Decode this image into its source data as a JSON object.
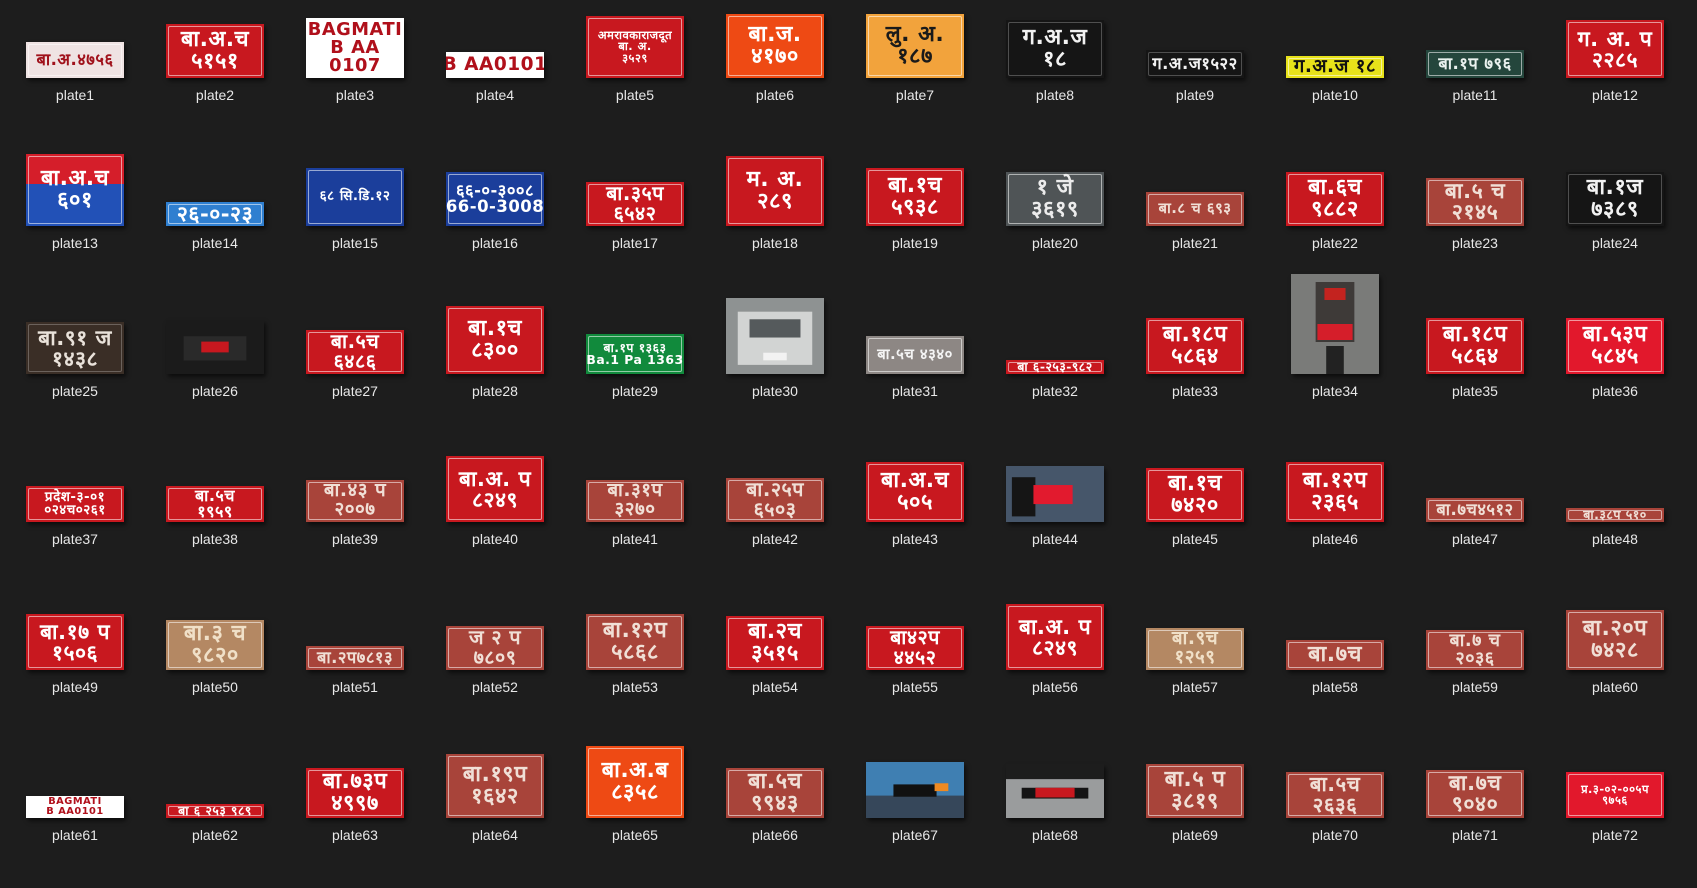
{
  "window": {
    "background": "#1d1d1d"
  },
  "items": [
    {
      "label": "plate1",
      "style": "light",
      "text": "बा.अ.४७५६",
      "photo": false
    },
    {
      "label": "plate2",
      "style": "red",
      "text": "बा.अ.च\n५१५१",
      "photo": false
    },
    {
      "label": "plate3",
      "style": "white",
      "text": "BAGMATI\nB AA\n0107",
      "photo": false
    },
    {
      "label": "plate4",
      "style": "white",
      "text": "B AA0101",
      "photo": false
    },
    {
      "label": "plate5",
      "style": "red",
      "text": "अमरावकाराजदूत\nबा. अ.\n३५२९",
      "photo": false
    },
    {
      "label": "plate6",
      "style": "orange",
      "text": "बा.ज.\n४१७०",
      "photo": false
    },
    {
      "label": "plate7",
      "style": "yellow",
      "text": "लु. अ.\n१८७",
      "photo": false
    },
    {
      "label": "plate8",
      "style": "black",
      "text": "ग.अ.ज\n१८",
      "photo": false
    },
    {
      "label": "plate9",
      "style": "black",
      "text": "ग.अ.ज१५२२",
      "photo": false
    },
    {
      "label": "plate10",
      "style": "yellowbright",
      "text": "ग.अ.ज १८",
      "photo": false
    },
    {
      "label": "plate11",
      "style": "darkgreen",
      "text": "बा.१प ७९६",
      "photo": false
    },
    {
      "label": "plate12",
      "style": "red",
      "text": "ग. अ. प\n२२८५",
      "photo": false
    },
    {
      "label": "plate13",
      "style": "split",
      "text": "बा.अ.च\n६०१",
      "photo": false
    },
    {
      "label": "plate14",
      "style": "blue",
      "text": "२६-०-२३",
      "photo": false
    },
    {
      "label": "plate15",
      "style": "navy",
      "text": "६८ सि.डि.१२",
      "photo": false
    },
    {
      "label": "plate16",
      "style": "navy",
      "text": "६६-०-३००८\n66-0-3008",
      "photo": false
    },
    {
      "label": "plate17",
      "style": "red",
      "text": "बा.३५प\n६५४२",
      "photo": false
    },
    {
      "label": "plate18",
      "style": "red",
      "text": "म. अ.\n२८९",
      "photo": false
    },
    {
      "label": "plate19",
      "style": "red",
      "text": "बा.१च\n५९३८",
      "photo": false
    },
    {
      "label": "plate20",
      "style": "grey",
      "text": "१ जे\n३६१९",
      "photo": false
    },
    {
      "label": "plate21",
      "style": "rust",
      "text": "बा.८ च ६९३",
      "photo": false
    },
    {
      "label": "plate22",
      "style": "red",
      "text": "बा.६च\n९८८२",
      "photo": false
    },
    {
      "label": "plate23",
      "style": "rust",
      "text": "बा.५ च\n२१४५",
      "photo": false
    },
    {
      "label": "plate24",
      "style": "black",
      "text": "बा.१ज\n७३८९",
      "photo": false
    },
    {
      "label": "plate25",
      "style": "darkbrown",
      "text": "बा.९१ ज\n१४३८",
      "photo": false
    },
    {
      "label": "plate26",
      "style": "photo",
      "text": "",
      "photo": true
    },
    {
      "label": "plate27",
      "style": "red",
      "text": "बा.५च\n६४८६",
      "photo": false
    },
    {
      "label": "plate28",
      "style": "red",
      "text": "बा.१च\n८३००",
      "photo": false
    },
    {
      "label": "plate29",
      "style": "green",
      "text": "बा.१प १३६३\nBa.1 Pa 1363",
      "photo": false
    },
    {
      "label": "plate30",
      "style": "photo",
      "text": "",
      "photo": true
    },
    {
      "label": "plate31",
      "style": "greyphoto",
      "text": "बा.५च ४३४०",
      "photo": false
    },
    {
      "label": "plate32",
      "style": "red",
      "text": "बा ६-२५३-९८२",
      "photo": false
    },
    {
      "label": "plate33",
      "style": "red",
      "text": "बा.१८प\n५८६४",
      "photo": false
    },
    {
      "label": "plate34",
      "style": "photo",
      "text": "",
      "photo": true
    },
    {
      "label": "plate35",
      "style": "red",
      "text": "बा.१८प\n५८६४",
      "photo": false
    },
    {
      "label": "plate36",
      "style": "brightred",
      "text": "बा.५३प\n५८४५",
      "photo": false
    },
    {
      "label": "plate37",
      "style": "red",
      "text": "प्रदेश-३-०१\n०२४च०२६१",
      "photo": false
    },
    {
      "label": "plate38",
      "style": "red",
      "text": "बा.५च\n१९५९",
      "photo": false
    },
    {
      "label": "plate39",
      "style": "rust",
      "text": "बा.४३ प\n२००७",
      "photo": false
    },
    {
      "label": "plate40",
      "style": "red",
      "text": "बा.अ. प\n८२४९",
      "photo": false
    },
    {
      "label": "plate41",
      "style": "rust",
      "text": "बा.३१प\n३२७०",
      "photo": false
    },
    {
      "label": "plate42",
      "style": "rust",
      "text": "बा.२५प\n६५०३",
      "photo": false
    },
    {
      "label": "plate43",
      "style": "red",
      "text": "बा.अ.च\n५०५",
      "photo": false
    },
    {
      "label": "plate44",
      "style": "photo",
      "text": "",
      "photo": true
    },
    {
      "label": "plate45",
      "style": "red",
      "text": "बा.१च\n७४२०",
      "photo": false
    },
    {
      "label": "plate46",
      "style": "red",
      "text": "बा.१२प\n२३६५",
      "photo": false
    },
    {
      "label": "plate47",
      "style": "rust",
      "text": "बा.७च४५१२",
      "photo": false
    },
    {
      "label": "plate48",
      "style": "rust",
      "text": "बा.३८प ५१०",
      "photo": false
    },
    {
      "label": "plate49",
      "style": "red",
      "text": "बा.१७ प\n१५०६",
      "photo": false
    },
    {
      "label": "plate50",
      "style": "tan",
      "text": "बा.३ च\n९८२०",
      "photo": false
    },
    {
      "label": "plate51",
      "style": "rust",
      "text": "बा.२प७८१३",
      "photo": false
    },
    {
      "label": "plate52",
      "style": "rust",
      "text": "ज २ प\n७८०९",
      "photo": false
    },
    {
      "label": "plate53",
      "style": "rust",
      "text": "बा.१२प\n५८६८",
      "photo": false
    },
    {
      "label": "plate54",
      "style": "red",
      "text": "बा.२च\n३५१५",
      "photo": false
    },
    {
      "label": "plate55",
      "style": "red",
      "text": "बा४२प\n४४५२",
      "photo": false
    },
    {
      "label": "plate56",
      "style": "red",
      "text": "बा.अ. प\n८२४९",
      "photo": false
    },
    {
      "label": "plate57",
      "style": "tan",
      "text": "बा.९च\n१२५९",
      "photo": false
    },
    {
      "label": "plate58",
      "style": "rust",
      "text": "बा.७च",
      "photo": false
    },
    {
      "label": "plate59",
      "style": "rust",
      "text": "बा.७ च\n२०३६",
      "photo": false
    },
    {
      "label": "plate60",
      "style": "rust",
      "text": "बा.२०प\n७४२८",
      "photo": false
    },
    {
      "label": "plate61",
      "style": "white",
      "text": "BAGMATI\nB AA0101",
      "photo": false
    },
    {
      "label": "plate62",
      "style": "red",
      "text": "बा ६ २५३ ९८९",
      "photo": false
    },
    {
      "label": "plate63",
      "style": "red",
      "text": "बा.७३प\n४९९७",
      "photo": false
    },
    {
      "label": "plate64",
      "style": "rust",
      "text": "बा.१९प\n१६४२",
      "photo": false
    },
    {
      "label": "plate65",
      "style": "orange",
      "text": "बा.अ.ब\n८३५८",
      "photo": false
    },
    {
      "label": "plate66",
      "style": "rust",
      "text": "बा.५च\n९९४३",
      "photo": false
    },
    {
      "label": "plate67",
      "style": "photo",
      "text": "",
      "photo": true
    },
    {
      "label": "plate68",
      "style": "photo",
      "text": "",
      "photo": true
    },
    {
      "label": "plate69",
      "style": "rust",
      "text": "बा.५ प\n३८१९",
      "photo": false
    },
    {
      "label": "plate70",
      "style": "rust",
      "text": "बा.५च\n२६३६",
      "photo": false
    },
    {
      "label": "plate71",
      "style": "rust",
      "text": "बा.७च\n९०४०",
      "photo": false
    },
    {
      "label": "plate72",
      "style": "brightred",
      "text": "प्र.३-०२-००५प\n९७५६",
      "photo": false
    }
  ]
}
